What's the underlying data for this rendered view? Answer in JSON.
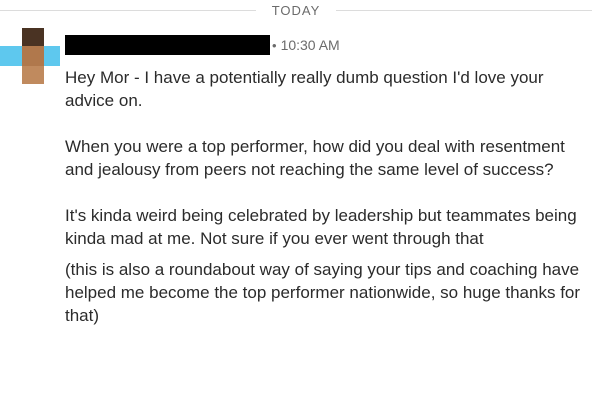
{
  "divider": {
    "label": "TODAY"
  },
  "message": {
    "sender_name": "",
    "separator": "•",
    "timestamp": "10:30 AM",
    "paragraphs": [
      "Hey Mor - I have a potentially really dumb question I'd love your advice on.",
      "When you were a top performer, how did you deal with resentment and jealousy from peers not reaching the same level of success?",
      "It's kinda weird being celebrated by leadership but teammates being kinda mad at me. Not sure if you ever went through that",
      "(this is also a roundabout way of saying your tips and coaching have helped me become the top performer nationwide, so huge thanks for that)"
    ]
  },
  "colors": {
    "redaction": "#000000",
    "meta_text": "#6b6b6b",
    "body_text": "#2b2b2b",
    "divider_line": "#dcdcdc",
    "avatar_dark_brown": "#4a3323",
    "avatar_brown": "#b0784c",
    "avatar_tan": "#c08a5e",
    "avatar_sky": "#5ec8ee"
  },
  "icons": {
    "avatar": "pixelated-avatar"
  }
}
